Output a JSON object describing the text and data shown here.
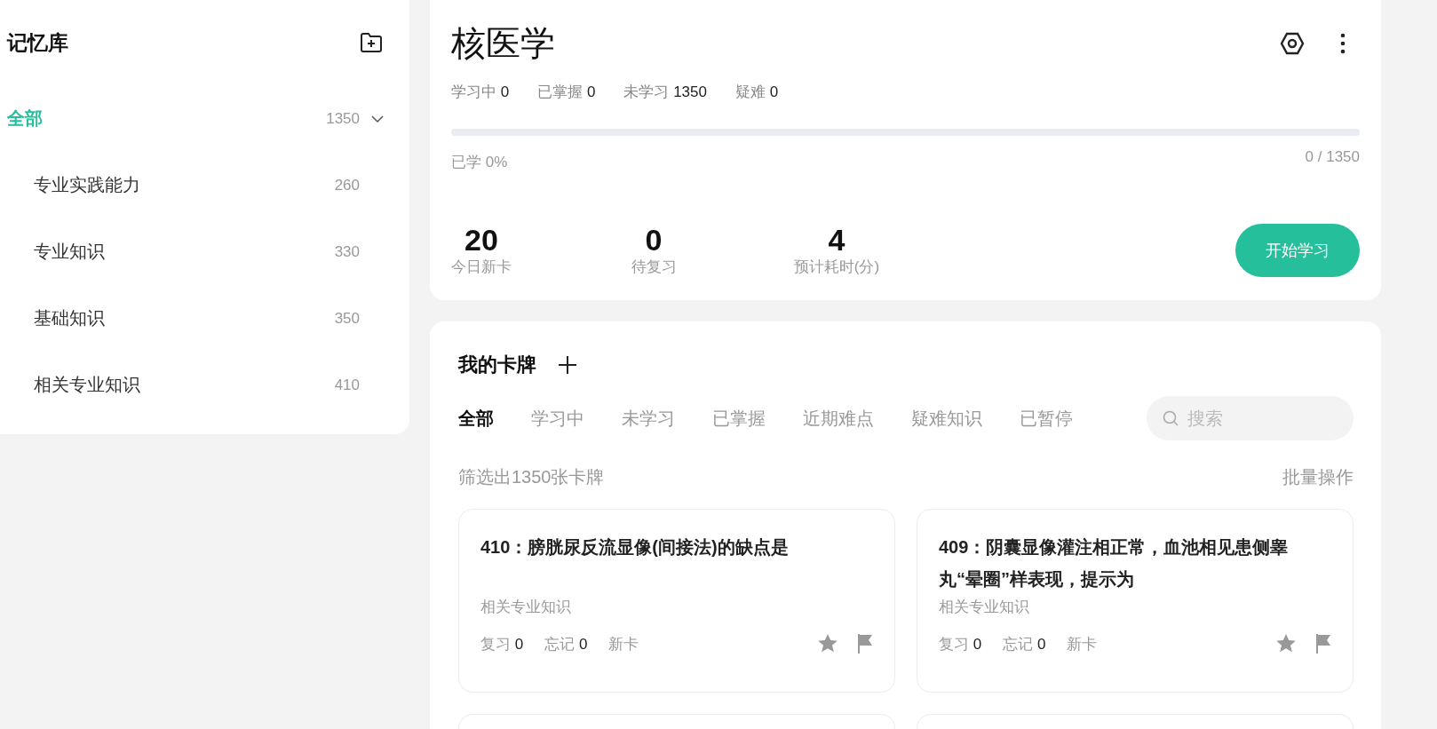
{
  "sidebar": {
    "title": "记忆库",
    "root": {
      "label": "全部",
      "count": "1350",
      "selected": true,
      "expanded": true,
      "children": [
        {
          "label": "专业实践能力",
          "count": "260",
          "selected": false
        },
        {
          "label": "专业知识",
          "count": "330",
          "selected": false
        },
        {
          "label": "基础知识",
          "count": "350",
          "selected": false
        },
        {
          "label": "相关专业知识",
          "count": "410",
          "selected": false
        }
      ]
    }
  },
  "deck": {
    "title": "核医学",
    "stats": [
      {
        "label": "学习中",
        "value": "0"
      },
      {
        "label": "已掌握",
        "value": "0"
      },
      {
        "label": "未学习",
        "value": "1350"
      },
      {
        "label": "疑难",
        "value": "0"
      }
    ],
    "progress": {
      "level": 0,
      "label": "已学 0%",
      "reading": "0 / 1350"
    },
    "metrics": [
      {
        "value": "20",
        "label": "今日新卡"
      },
      {
        "value": "0",
        "label": "待复习"
      },
      {
        "value": "4",
        "label": "预计耗时(分)"
      }
    ],
    "start_button": "开始学习"
  },
  "cards_panel": {
    "title": "我的卡牌",
    "tabs": [
      {
        "label": "全部",
        "selected": true
      },
      {
        "label": "学习中",
        "selected": false
      },
      {
        "label": "未学习",
        "selected": false
      },
      {
        "label": "已掌握",
        "selected": false
      },
      {
        "label": "近期难点",
        "selected": false
      },
      {
        "label": "疑难知识",
        "selected": false
      },
      {
        "label": "已暂停",
        "selected": false
      }
    ],
    "search": {
      "placeholder": "搜索"
    },
    "filter_summary": "筛选出1350张卡牌",
    "batch_action": "批量操作",
    "cards": [
      {
        "question": "410：膀胱尿反流显像(间接法)的缺点是",
        "category": "相关专业知识",
        "review": {
          "label": "复习",
          "value": "0"
        },
        "forget": {
          "label": "忘记",
          "value": "0"
        },
        "status": "新卡"
      },
      {
        "question": "409：阴囊显像灌注相正常，血池相见患侧睾丸“晕圈”样表现，提示为",
        "category": "相关专业知识",
        "review": {
          "label": "复习",
          "value": "0"
        },
        "forget": {
          "label": "忘记",
          "value": "0"
        },
        "status": "新卡"
      }
    ]
  }
}
